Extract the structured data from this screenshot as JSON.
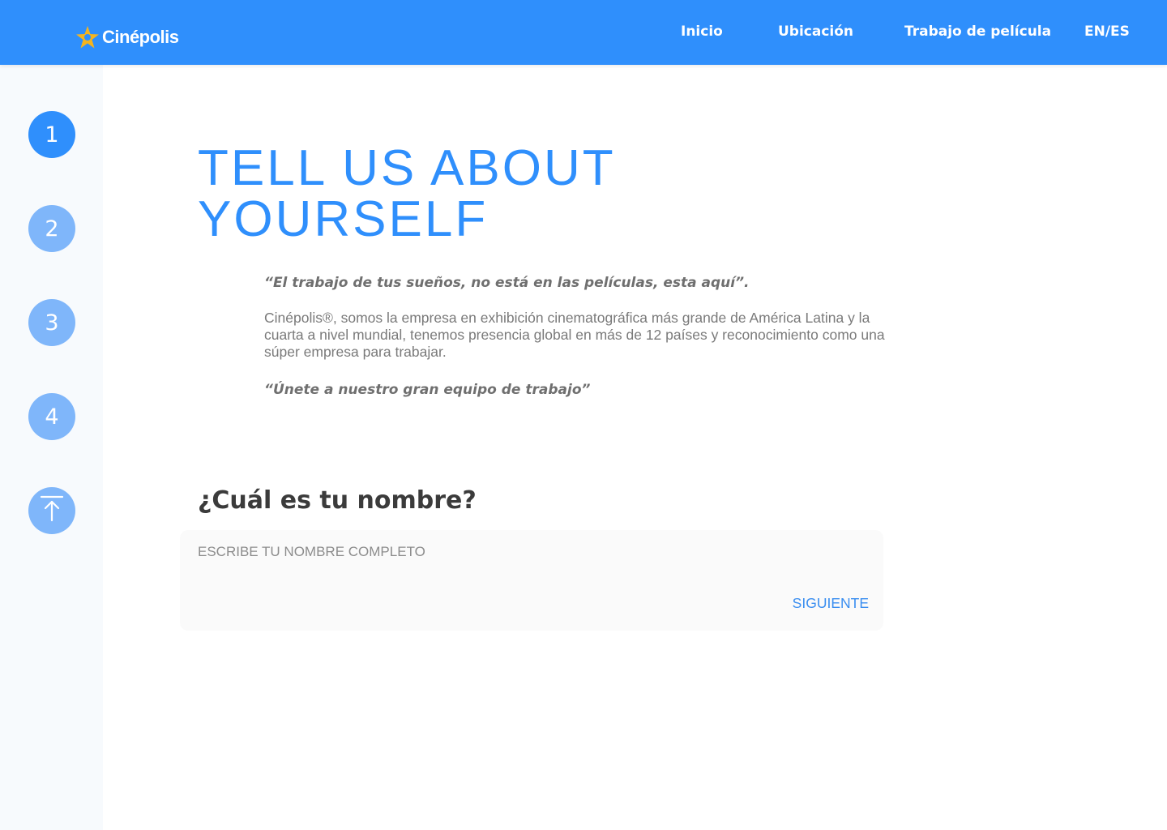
{
  "brand": {
    "name": "Cinépolis",
    "color": "#2f8ffc",
    "star_color": "#f5b41f"
  },
  "nav": {
    "items": [
      {
        "label": "Inicio"
      },
      {
        "label": "Ubicación"
      },
      {
        "label": "Trabajo de película"
      }
    ],
    "language": "EN/ES"
  },
  "steps": {
    "items": [
      {
        "label": "1",
        "state": "active"
      },
      {
        "label": "2",
        "state": "inactive"
      },
      {
        "label": "3",
        "state": "inactive"
      },
      {
        "label": "4",
        "state": "inactive"
      }
    ],
    "upload_icon": "upload-icon"
  },
  "main": {
    "title_line1": "TELL US ABOUT",
    "title_line2": "YOURSELF",
    "quote1": "“El trabajo de tus sueños, no está en las películas, esta aquí”.",
    "intro": "Cinépolis®, somos la empresa en exhibición cinematográfica más grande de América Latina y la cuarta a nivel mundial, tenemos presencia global en más de 12 países y reconocimiento como una súper empresa para trabajar.",
    "quote2": "“Únete a nuestro gran equipo de trabajo”"
  },
  "form": {
    "question": "¿Cuál es tu nombre?",
    "placeholder": "ESCRIBE TU NOMBRE COMPLETO",
    "value": "",
    "next_label": "SIGUIENTE"
  }
}
